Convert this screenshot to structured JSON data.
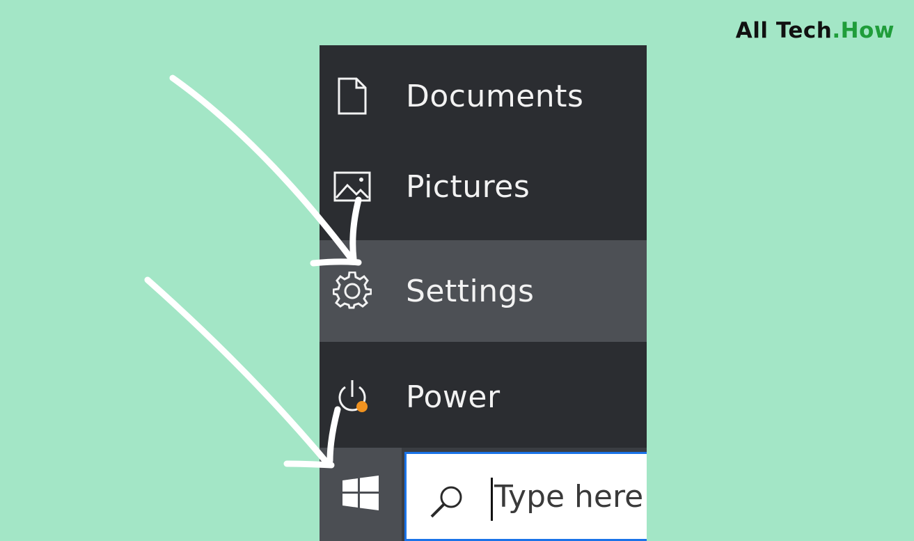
{
  "brand": {
    "name_part1": "All Tech",
    "name_part2": ".How"
  },
  "menu": {
    "items": [
      {
        "label": "Documents",
        "icon": "document-icon"
      },
      {
        "label": "Pictures",
        "icon": "pictures-icon"
      },
      {
        "label": "Settings",
        "icon": "gear-icon",
        "highlighted": true
      },
      {
        "label": "Power",
        "icon": "power-icon"
      }
    ]
  },
  "taskbar": {
    "start_icon": "windows-logo-icon",
    "search": {
      "placeholder": "Type here to search",
      "visible_text": "Type here t",
      "icon": "search-icon"
    }
  },
  "colors": {
    "background": "#a3e6c6",
    "panel": "#2b2d31",
    "highlight": "#4d5055",
    "search_border": "#1a73e8",
    "brand_accent": "#1f9d3a",
    "power_badge": "#f0921f"
  }
}
